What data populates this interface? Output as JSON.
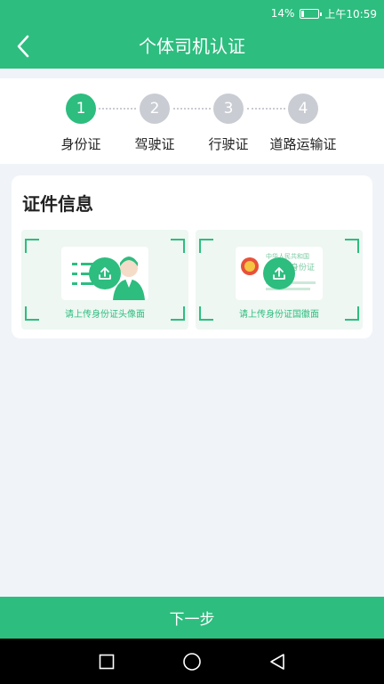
{
  "status_bar": {
    "battery": "14%",
    "time": "上午10:59",
    "battery_level": 0.14
  },
  "header": {
    "title": "个体司机认证",
    "back_icon": "chevron-left-icon"
  },
  "steps": [
    {
      "number": "1",
      "label": "身份证",
      "active": true
    },
    {
      "number": "2",
      "label": "驾驶证",
      "active": false
    },
    {
      "number": "3",
      "label": "行驶证",
      "active": false
    },
    {
      "number": "4",
      "label": "道路运输证",
      "active": false
    }
  ],
  "card": {
    "title": "证件信息",
    "uploads": [
      {
        "caption": "请上传身份证头像面",
        "icon": "upload-icon"
      },
      {
        "caption": "请上传身份证国徽面",
        "icon": "upload-icon",
        "card_text_1": "中华人民共和国",
        "card_text_2": "身份证"
      }
    ]
  },
  "footer": {
    "next_label": "下一步"
  },
  "colors": {
    "primary": "#2dbd7f",
    "inactive_step": "#c9ccd3",
    "background": "#f0f4f8"
  }
}
